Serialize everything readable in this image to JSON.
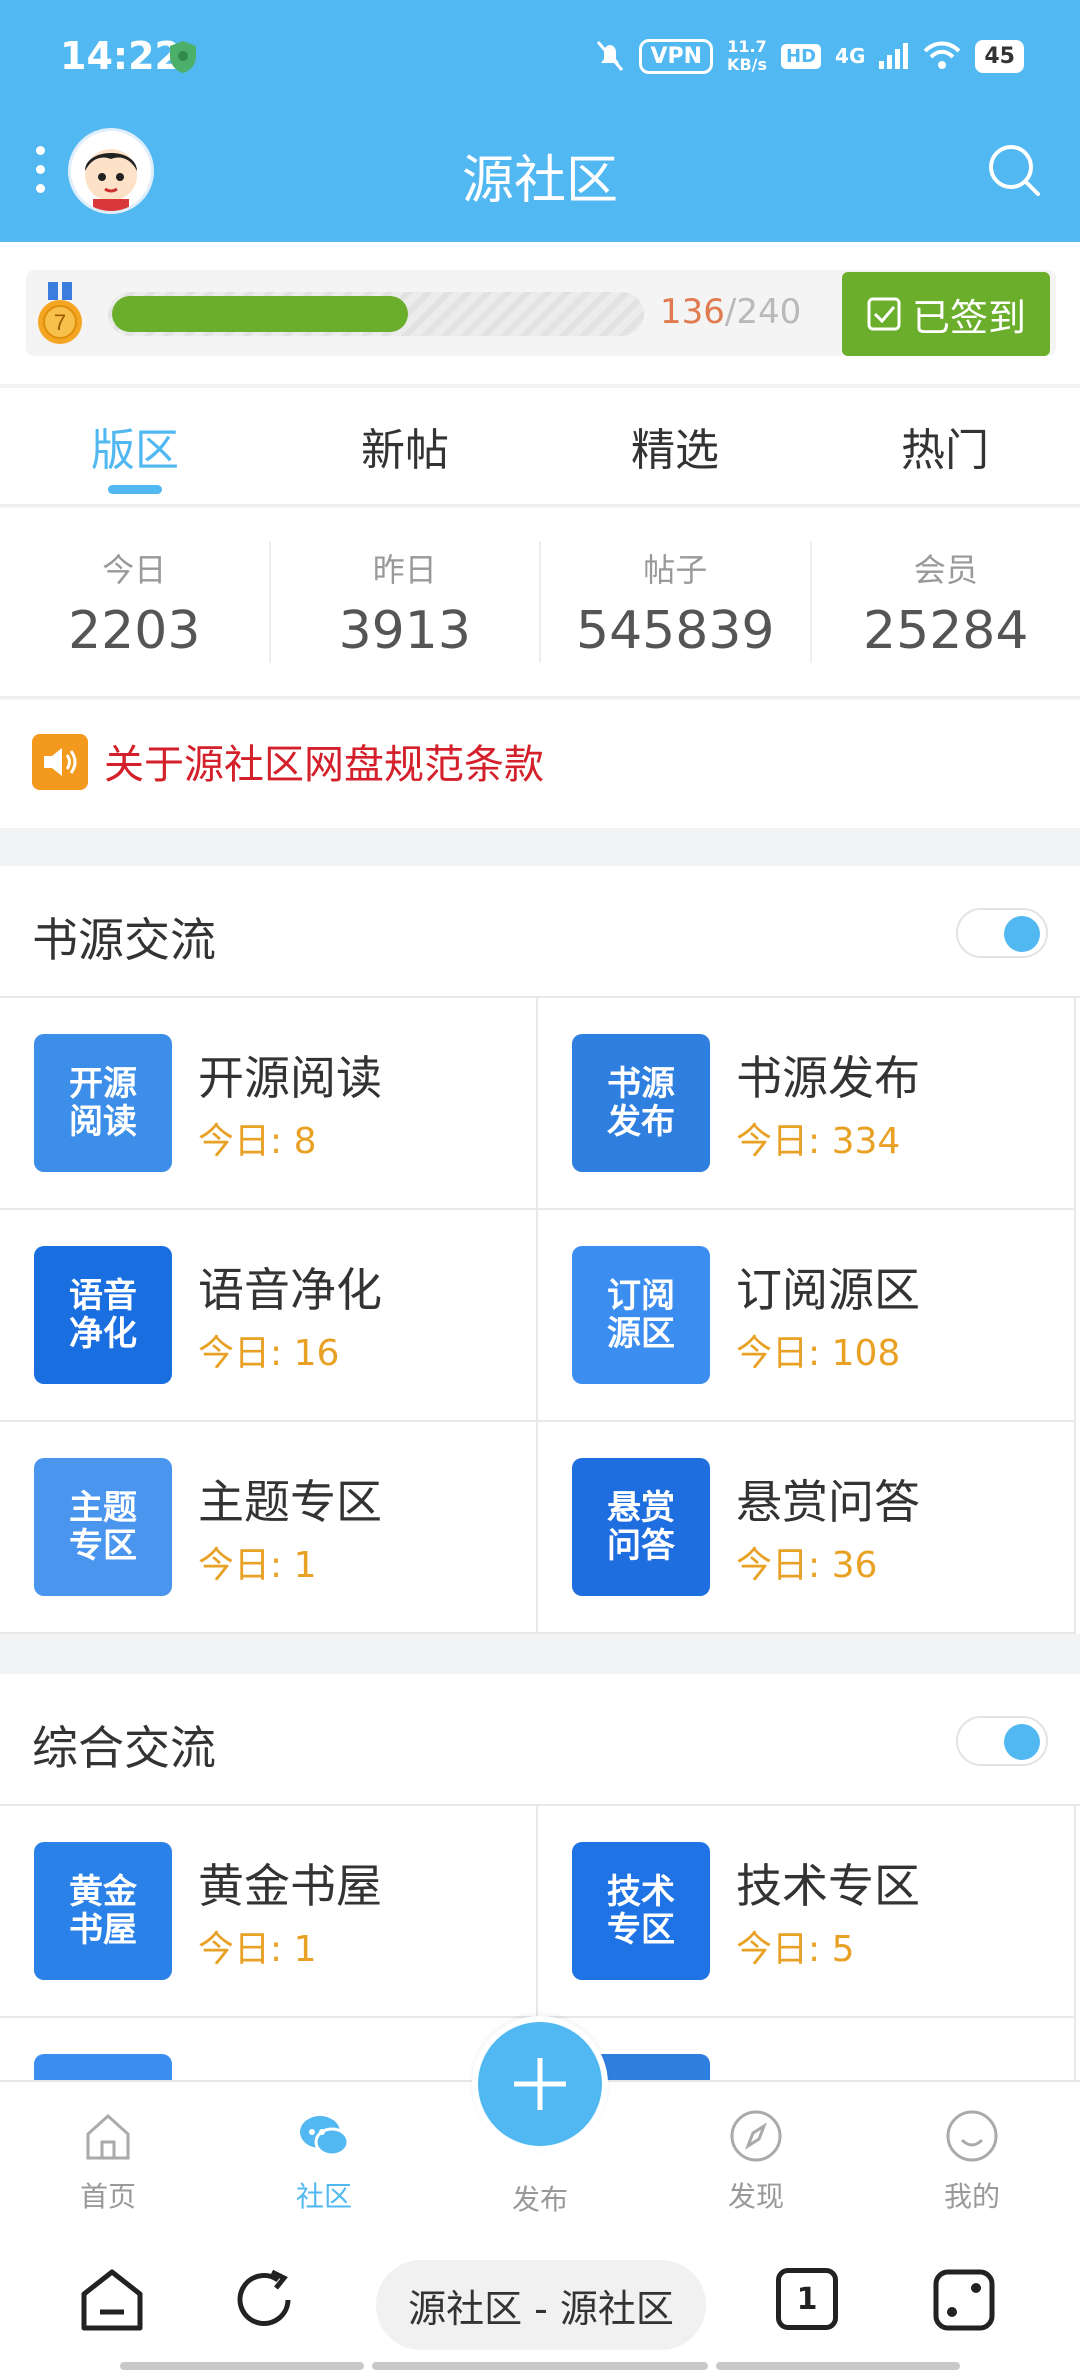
{
  "status_bar": {
    "time": "14:22",
    "vpn": "VPN",
    "speed_value": "11.7",
    "speed_unit": "KB/s",
    "hd": "HD",
    "network": "4G",
    "battery": "45"
  },
  "header": {
    "title": "源社区"
  },
  "sign": {
    "level": "7",
    "current": "136",
    "separator": "/",
    "total": "240",
    "progress_fraction": 0.567,
    "button_label": "已签到"
  },
  "tabs": [
    {
      "label": "版区",
      "active": true
    },
    {
      "label": "新帖",
      "active": false
    },
    {
      "label": "精选",
      "active": false
    },
    {
      "label": "热门",
      "active": false
    }
  ],
  "stats": [
    {
      "label": "今日",
      "value": "2203"
    },
    {
      "label": "昨日",
      "value": "3913"
    },
    {
      "label": "帖子",
      "value": "545839"
    },
    {
      "label": "会员",
      "value": "25284"
    }
  ],
  "notice": {
    "text": "关于源社区网盘规范条款"
  },
  "sections": [
    {
      "title": "书源交流",
      "boards": [
        {
          "name": "开源阅读",
          "today_label": "今日: ",
          "today": "8",
          "thumb_text": "开源\n阅读",
          "thumb_color": "#3d8ee8"
        },
        {
          "name": "书源发布",
          "today_label": "今日: ",
          "today": "334",
          "thumb_text": "书源\n发布",
          "thumb_color": "#2f7fe0"
        },
        {
          "name": "语音净化",
          "today_label": "今日: ",
          "today": "16",
          "thumb_text": "语音\n净化",
          "thumb_color": "#1a6fe0"
        },
        {
          "name": "订阅源区",
          "today_label": "今日: ",
          "today": "108",
          "thumb_text": "订阅\n源区",
          "thumb_color": "#3b8ef0"
        },
        {
          "name": "主题专区",
          "today_label": "今日: ",
          "today": "1",
          "thumb_text": "主题\n专区",
          "thumb_color": "#4a95ee"
        },
        {
          "name": "悬赏问答",
          "today_label": "今日: ",
          "today": "36",
          "thumb_text": "悬赏\n问答",
          "thumb_color": "#1f6ee0"
        }
      ]
    },
    {
      "title": "综合交流",
      "boards": [
        {
          "name": "黄金书屋",
          "today_label": "今日: ",
          "today": "1",
          "thumb_text": "黄金\n书屋",
          "thumb_color": "#2a82e8"
        },
        {
          "name": "技术专区",
          "today_label": "今日: ",
          "today": "5",
          "thumb_text": "技术\n专区",
          "thumb_color": "#1f73e4"
        }
      ]
    }
  ],
  "bottom_nav": [
    {
      "label": "首页",
      "icon": "home-icon",
      "active": false
    },
    {
      "label": "社区",
      "icon": "chat-icon",
      "active": true
    },
    {
      "label": "发布",
      "icon": "plus-icon",
      "active": false
    },
    {
      "label": "发现",
      "icon": "compass-icon",
      "active": false
    },
    {
      "label": "我的",
      "icon": "smile-icon",
      "active": false
    }
  ],
  "browser_bar": {
    "url_text": "源社区 - 源社区",
    "tab_count": "1"
  },
  "colors": {
    "primary": "#52b8f2",
    "sign_green": "#6aae2c",
    "notice_red": "#d4202a",
    "today_orange": "#e8a125"
  }
}
